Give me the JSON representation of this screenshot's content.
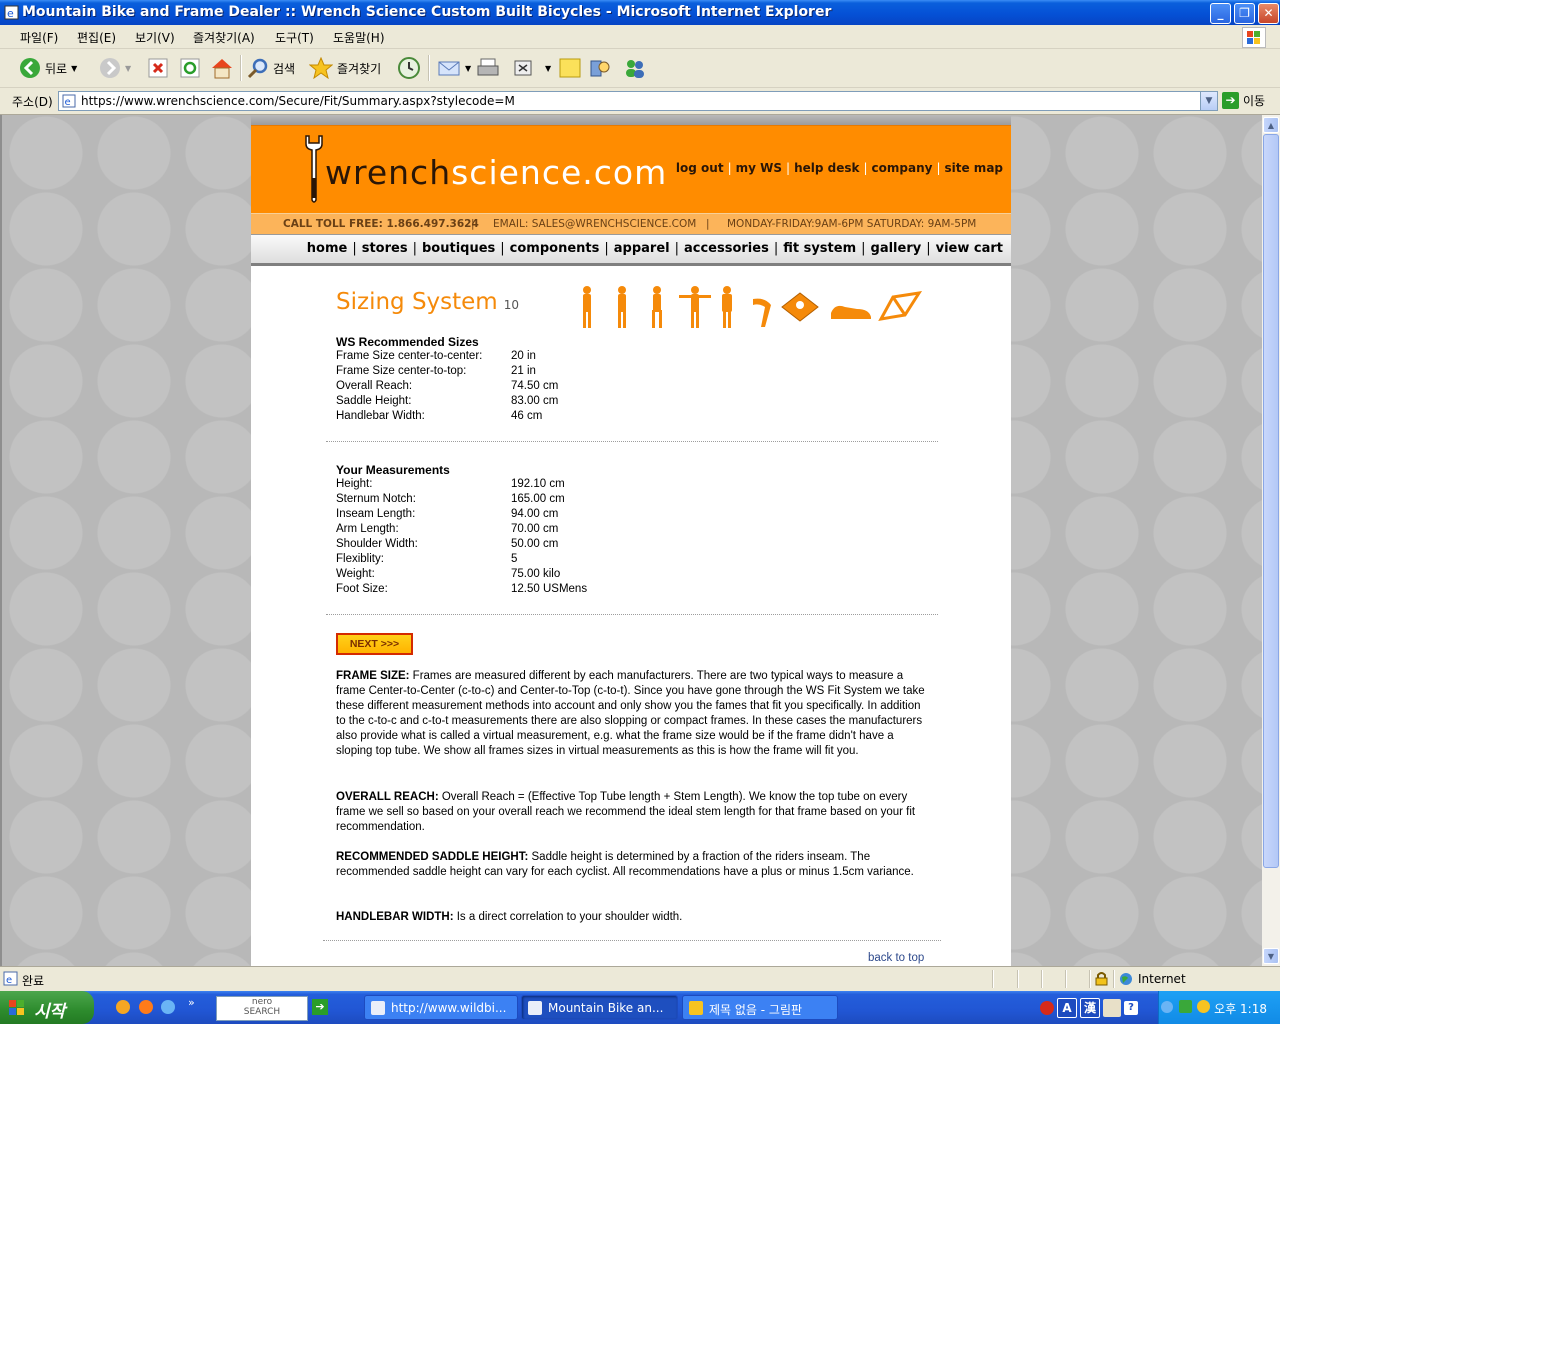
{
  "window": {
    "title": "Mountain Bike and Frame Dealer :: Wrench Science Custom Built Bicycles - Microsoft Internet Explorer",
    "min": "_",
    "max": "❐",
    "close": "✕"
  },
  "menu": [
    "파일(F)",
    "편집(E)",
    "보기(V)",
    "즐겨찾기(A)",
    "도구(T)",
    "도움말(H)"
  ],
  "toolbar": {
    "back": "뒤로",
    "search": "검색",
    "favorites": "즐겨찾기"
  },
  "address": {
    "label": "주소(D)",
    "url": "https://www.wrenchscience.com/Secure/Fit/Summary.aspx?stylecode=M",
    "go": "이동"
  },
  "site": {
    "logo_pre": "wrench",
    "logo_mid": "science",
    "logo_post": ".com",
    "toplinks": [
      "log out",
      "my WS",
      "help desk",
      "company",
      "site map"
    ],
    "info": {
      "phone": "CALL TOLL FREE: 1.866.497.3624",
      "email": "EMAIL: SALES@WRENCHSCIENCE.COM",
      "hours": "MONDAY-FRIDAY:9AM-6PM SATURDAY: 9AM-5PM",
      "divider": "|"
    },
    "nav": [
      "home",
      "stores",
      "boutiques",
      "components",
      "apparel",
      "accessories",
      "fit system",
      "gallery",
      "view cart"
    ]
  },
  "sizing": {
    "title": "Sizing System",
    "step": "10",
    "recommended_heading": "WS Recommended Sizes",
    "recommended": [
      {
        "label": "Frame Size center-to-center:",
        "value": "20 in"
      },
      {
        "label": "Frame Size center-to-top:",
        "value": "21 in"
      },
      {
        "label": "Overall Reach:",
        "value": "74.50 cm"
      },
      {
        "label": "Saddle Height:",
        "value": "83.00 cm"
      },
      {
        "label": "Handlebar Width:",
        "value": "46 cm"
      }
    ],
    "measurements_heading": "Your Measurements",
    "measurements": [
      {
        "label": "Height:",
        "value": "192.10 cm"
      },
      {
        "label": "Sternum Notch:",
        "value": "165.00 cm"
      },
      {
        "label": "Inseam Length:",
        "value": "94.00 cm"
      },
      {
        "label": "Arm Length:",
        "value": "70.00 cm"
      },
      {
        "label": "Shoulder Width:",
        "value": "50.00 cm"
      },
      {
        "label": "Flexiblity:",
        "value": "5"
      },
      {
        "label": "Weight:",
        "value": "75.00 kilo"
      },
      {
        "label": "Foot Size:",
        "value": "12.50 USMens"
      }
    ],
    "next": "NEXT >>>",
    "paras": [
      {
        "head": "FRAME SIZE:",
        "text": " Frames are measured different by each manufacturers. There are two typical ways to measure a frame Center-to-Center (c-to-c) and Center-to-Top (c-to-t). Since you have gone through the WS Fit System we take these different measurement methods into account and only show you the fames that fit you specifically. In addition to the c-to-c and c-to-t measurements there are also slopping or compact frames. In these cases the manufacturers also provide what is called a virtual measurement, e.g. what the frame size would be if the frame didn't have a sloping top tube. We show all frames sizes in virtual measurements as this is how the frame will fit you."
      },
      {
        "head": "OVERALL REACH:",
        "text": " Overall Reach = (Effective Top Tube length + Stem Length). We know the top tube on every frame we sell so based on your overall reach we recommend the ideal stem length for that frame based on your fit recommendation."
      },
      {
        "head": "RECOMMENDED SADDLE HEIGHT:",
        "text": " Saddle height is determined by a fraction of the riders inseam. The recommended saddle height can vary for each cyclist. All recommendations have a plus or minus 1.5cm variance."
      },
      {
        "head": "HANDLEBAR WIDTH:",
        "text": " Is a direct correlation to your shoulder width."
      }
    ],
    "back_to_top": "back to top"
  },
  "status": {
    "text": "완료",
    "zone": "Internet"
  },
  "taskbar": {
    "start": "시작",
    "nero": "nero\nSEARCH",
    "tasks": [
      "http://www.wildbi...",
      "Mountain Bike an...",
      "제목 없음 - 그림판"
    ],
    "ime": [
      "A",
      "漢"
    ],
    "clock": "오후 1:18"
  },
  "colors": {
    "brand_orange": "#ff8c00",
    "title_orange": "#f58a0a",
    "xp_blue": "#245edb",
    "start_green": "#2d8b2d"
  }
}
